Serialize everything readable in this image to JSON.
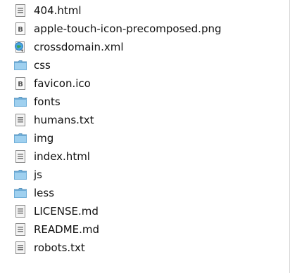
{
  "files": [
    {
      "name": "404.html",
      "icon": "html-file-icon"
    },
    {
      "name": "apple-touch-icon-precomposed.png",
      "icon": "image-file-icon"
    },
    {
      "name": "crossdomain.xml",
      "icon": "xml-file-icon"
    },
    {
      "name": "css",
      "icon": "folder-icon"
    },
    {
      "name": "favicon.ico",
      "icon": "image-file-icon"
    },
    {
      "name": "fonts",
      "icon": "folder-icon"
    },
    {
      "name": "humans.txt",
      "icon": "text-file-icon"
    },
    {
      "name": "img",
      "icon": "folder-icon"
    },
    {
      "name": "index.html",
      "icon": "html-file-icon"
    },
    {
      "name": "js",
      "icon": "folder-icon"
    },
    {
      "name": "less",
      "icon": "folder-icon"
    },
    {
      "name": "LICENSE.md",
      "icon": "text-file-icon"
    },
    {
      "name": "README.md",
      "icon": "text-file-icon"
    },
    {
      "name": "robots.txt",
      "icon": "text-file-icon"
    }
  ],
  "colors": {
    "folder": "#9fd0ef",
    "folder_dark": "#6faed8",
    "document": "#f4f4f4",
    "document_border": "#8a8a8a"
  }
}
